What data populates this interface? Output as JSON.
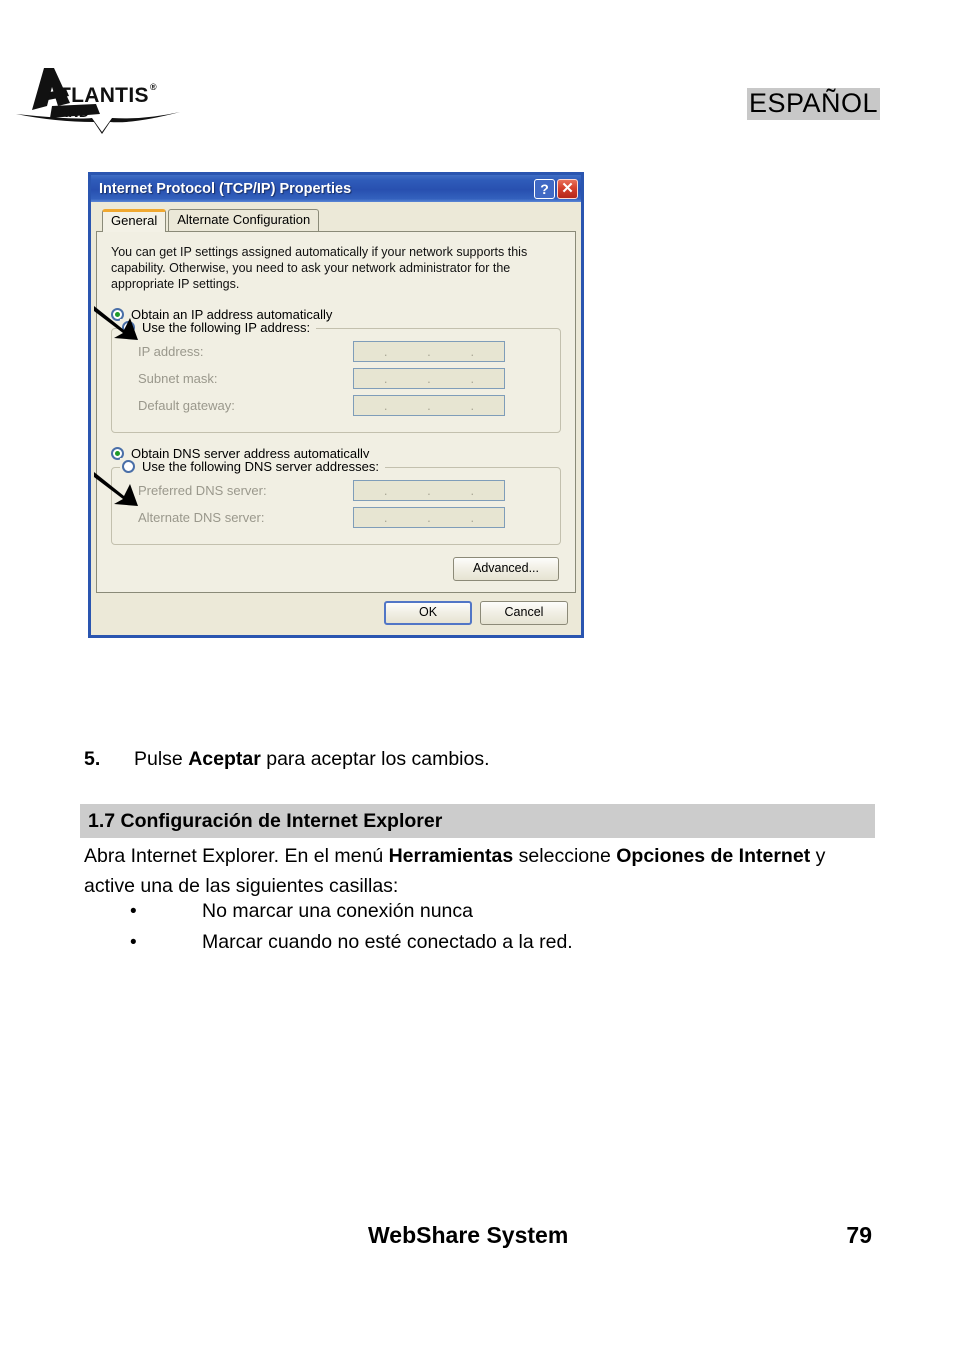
{
  "header": {
    "logo_alt": "Atlantis Land",
    "logo_text_main": "ATLANTIS",
    "logo_text_sub": "LAND",
    "logo_registered": "®",
    "language_badge": "ESPAÑOL"
  },
  "dialog": {
    "title": "Internet Protocol (TCP/IP) Properties",
    "help_button": "?",
    "close_button": "✕",
    "tabs": [
      {
        "label": "General",
        "active": true
      },
      {
        "label": "Alternate Configuration",
        "active": false
      }
    ],
    "intro": "You can get IP settings assigned automatically if your network supports this capability. Otherwise, you need to ask your network administrator for the appropriate IP settings.",
    "ip_auto_radio": "Obtain an IP address automatically",
    "ip_manual_radio": "Use the following IP address:",
    "ip_fields": [
      {
        "label": "IP address:",
        "value": ""
      },
      {
        "label": "Subnet mask:",
        "value": ""
      },
      {
        "label": "Default gateway:",
        "value": ""
      }
    ],
    "dns_auto_radio": "Obtain DNS server address automatically",
    "dns_manual_radio": "Use the following DNS server addresses:",
    "dns_fields": [
      {
        "label": "Preferred DNS server:",
        "value": ""
      },
      {
        "label": "Alternate DNS server:",
        "value": ""
      }
    ],
    "advanced_button": "Advanced...",
    "ok_button": "OK",
    "cancel_button": "Cancel",
    "ip_separator": ".",
    "colors": {
      "titlebar": "#2a55b0",
      "dialog_face": "#ece9d8",
      "panel_face": "#f1efe3",
      "tab_accent": "#f0a830",
      "radio_dot": "#1f9a2a",
      "field_bg": "#e7e5d2",
      "close_red": "#d4402c"
    }
  },
  "document": {
    "step": {
      "number": "5.",
      "text_before": "Pulse ",
      "bold": "Aceptar",
      "text_after": " para aceptar los cambios."
    },
    "section_heading": "1.7 Configuración de Internet Explorer",
    "paragraph": {
      "part1": "Abra Internet Explorer. En el menú ",
      "bold1": "Herramientas",
      "part2": " seleccione ",
      "bold2": "Opciones de Internet",
      "part3": " y active una de las siguientes casillas:"
    },
    "bullets": [
      "No marcar una conexión nunca",
      "Marcar cuando no esté conectado a la red."
    ],
    "bullet_glyph": "•",
    "heading_bg": "#cccccc"
  },
  "footer": {
    "title": "WebShare System",
    "page_number": "79"
  }
}
